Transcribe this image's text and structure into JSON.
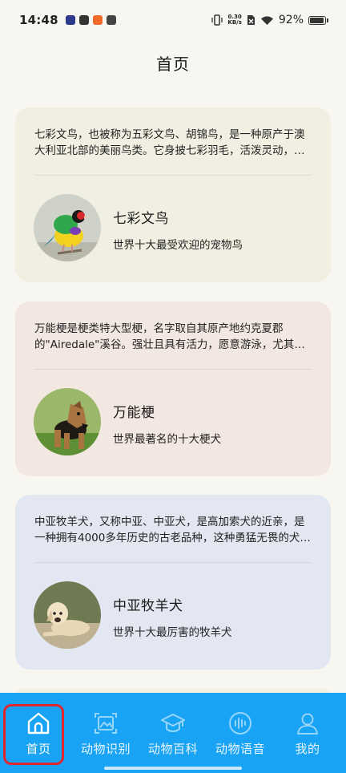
{
  "status_bar": {
    "time": "14:48",
    "net_speed_value": "0.30",
    "net_speed_unit": "KB/s",
    "battery": "92%",
    "battery_level": 0.92
  },
  "header": {
    "title": "首页"
  },
  "cards": [
    {
      "description": "七彩文鸟，也被称为五彩文鸟、胡锦鸟，是一种原产于澳大利亚北部的美丽鸟类。它身披七彩羽毛，活泼灵动，深受人们喜爱。",
      "name": "七彩文鸟",
      "subtitle": "世界十大最受欢迎的宠物鸟",
      "background": "#f0efe1",
      "avatar_icon": "gouldian-finch-photo"
    },
    {
      "description": "万能梗是梗类特大型梗，名字取自其原产地约克夏郡的\"Airedale\"溪谷。强壮且具有活力，愿意游泳，尤其擅长狩猎与守卫。",
      "name": "万能梗",
      "subtitle": "世界最著名的十大梗犬",
      "background": "#f3e7e1",
      "avatar_icon": "airedale-terrier-photo"
    },
    {
      "description": "中亚牧羊犬，又称中亚、中亚犬，是高加索犬的近亲，是一种拥有4000多年历史的古老品种，这种勇猛无畏的犬种体型巨大。",
      "name": "中亚牧羊犬",
      "subtitle": "世界十大最厉害的牧羊犬",
      "background": "#e3e7f2",
      "avatar_icon": "central-asian-shepherd-photo"
    }
  ],
  "bottom_nav": {
    "accent": "#19a3f5",
    "items": [
      {
        "label": "首页",
        "icon": "home-icon",
        "active": true
      },
      {
        "label": "动物识别",
        "icon": "image-scan-icon",
        "active": false
      },
      {
        "label": "动物百科",
        "icon": "graduation-cap-icon",
        "active": false
      },
      {
        "label": "动物语音",
        "icon": "audio-wave-icon",
        "active": false
      },
      {
        "label": "我的",
        "icon": "user-icon",
        "active": false
      }
    ]
  }
}
